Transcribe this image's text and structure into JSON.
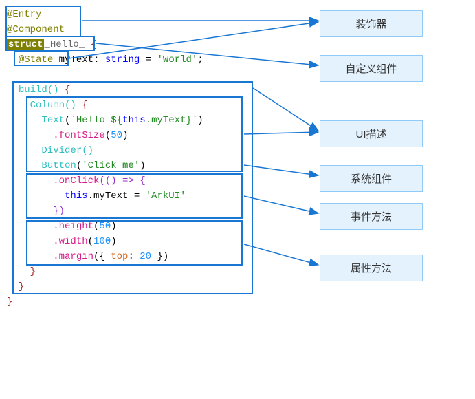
{
  "code": {
    "decorators": {
      "entry": "@Entry",
      "component": "@Component",
      "state": "@State"
    },
    "struct_kw": "struct",
    "struct_name": "_Hello_",
    "brace_open": "{",
    "brace_close": "}",
    "state_line": {
      "var": "myText",
      "colon": ":",
      "type": "string",
      "eq": "=",
      "value": "'World'",
      "semi": ";"
    },
    "build_fn": "build()",
    "column_fn": "Column()",
    "text_fn": "Text",
    "text_arg_prefix": "`Hello ${",
    "text_arg_this": "this",
    "text_arg_dot": ".myText}`",
    "fontSize": ".fontSize",
    "fontSize_val": "50",
    "divider": "Divider()",
    "button": "Button",
    "button_arg": "'Click me'",
    "onClick": ".onClick",
    "onClick_arrow": "(() => {",
    "onClick_this": "this",
    "onClick_assign": ".myText = ",
    "onClick_val": "'ArkUI'",
    "onClick_close": "})",
    "height": ".height",
    "height_val": "50",
    "width": ".width",
    "width_val": "100",
    "margin": ".margin",
    "margin_arg_open": "({ ",
    "margin_top": "top",
    "margin_colon": ": ",
    "margin_val": "20",
    "margin_arg_close": " })"
  },
  "labels": {
    "decorator": "装饰器",
    "custom_component": "自定义组件",
    "ui_desc": "UI描述",
    "system_component": "系统组件",
    "event_method": "事件方法",
    "attr_method": "属性方法"
  }
}
